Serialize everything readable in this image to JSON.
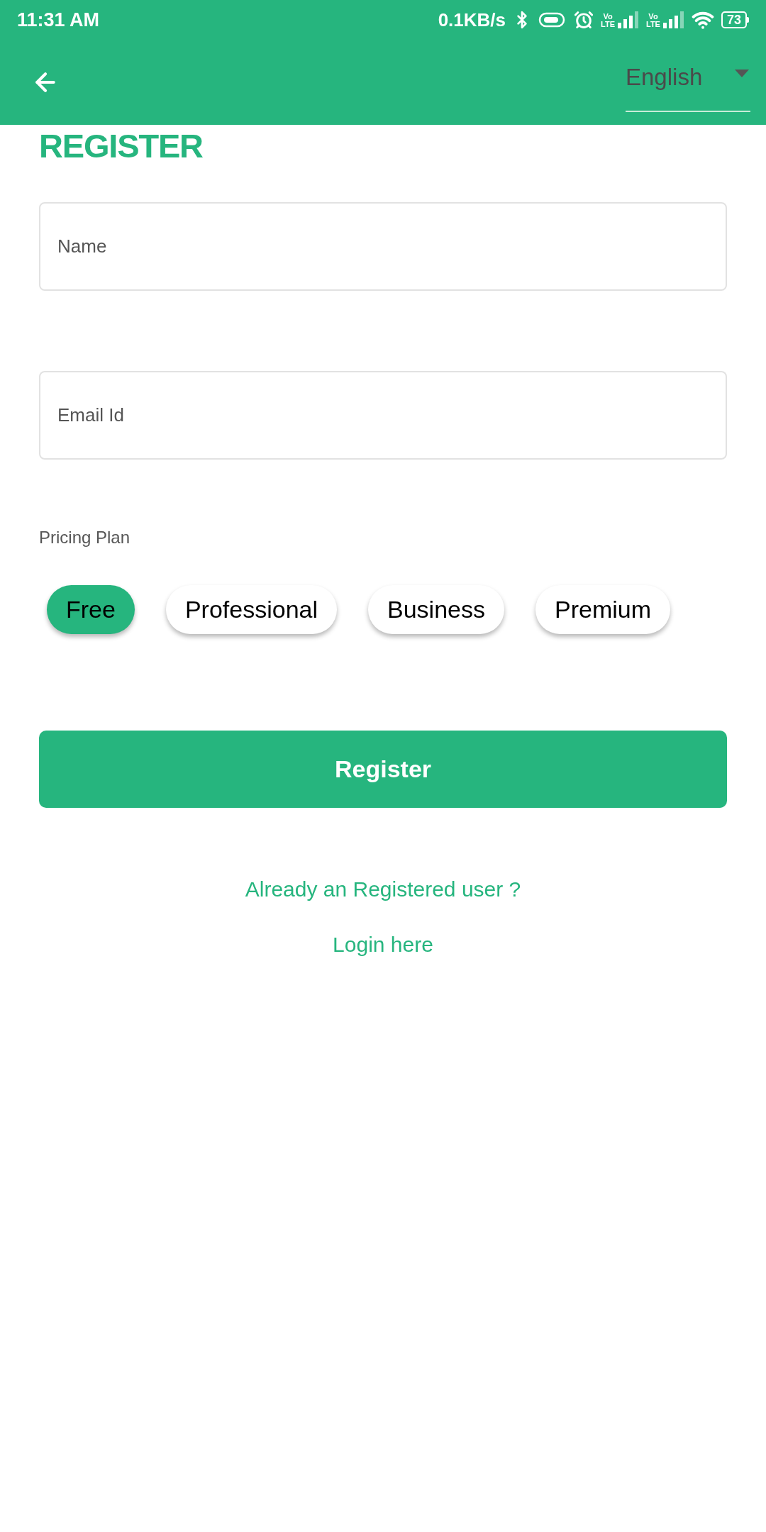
{
  "status_bar": {
    "time": "11:31 AM",
    "network_speed": "0.1KB/s",
    "sims": [
      {
        "volte": "Vo",
        "lte": "LTE"
      },
      {
        "volte": "Vo",
        "lte": "LTE"
      }
    ],
    "battery": "73"
  },
  "app_bar": {
    "language_select": {
      "value": "English"
    }
  },
  "title": "REGISTER",
  "fields": [
    {
      "placeholder": "Name"
    },
    {
      "placeholder": "Email Id"
    }
  ],
  "pricing": {
    "label": "Pricing Plan",
    "plans": [
      {
        "label": "Free",
        "selected": true
      },
      {
        "label": "Professional",
        "selected": false
      },
      {
        "label": "Business",
        "selected": false
      },
      {
        "label": "Premium",
        "selected": false
      }
    ]
  },
  "register_button": "Register",
  "footer": {
    "prompt": "Already an Registered user ?",
    "login_link": "Login here"
  }
}
